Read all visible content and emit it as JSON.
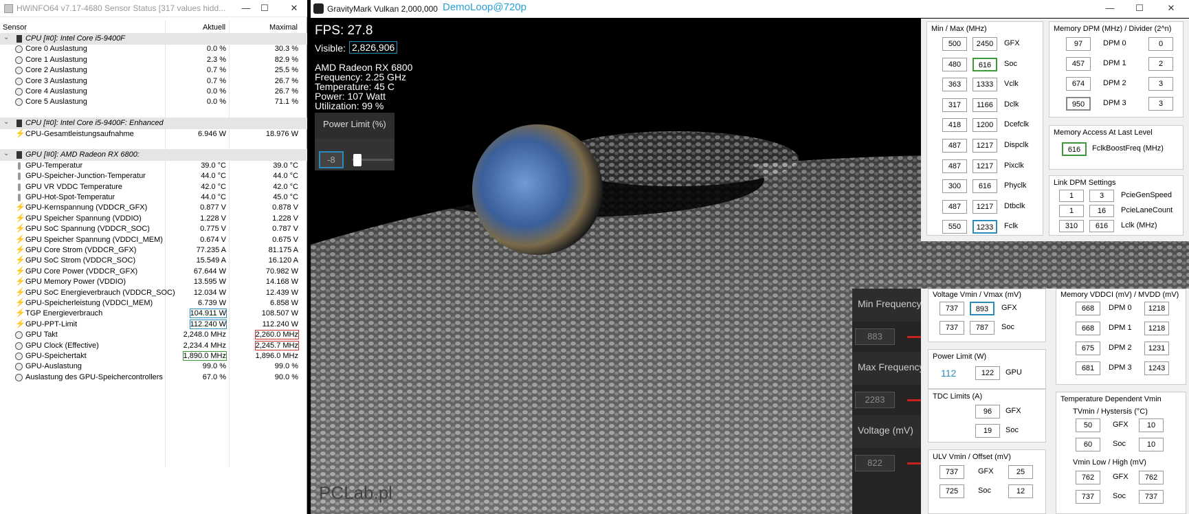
{
  "hwinfo": {
    "title": "HWiNFO64 v7.17-4680 Sensor Status [317 values hidd...",
    "columns": {
      "sensor": "Sensor",
      "current": "Aktuell",
      "max": "Maximal"
    },
    "groups": [
      {
        "label": "CPU [#0]: Intel Core i5-9400F",
        "rows": [
          {
            "label": "Core 0 Auslastung",
            "cur": "0.0 %",
            "max": "30.3 %",
            "icon": "circle-icon"
          },
          {
            "label": "Core 1 Auslastung",
            "cur": "2.3 %",
            "max": "82.9 %",
            "icon": "circle-icon"
          },
          {
            "label": "Core 2 Auslastung",
            "cur": "0.7 %",
            "max": "25.5 %",
            "icon": "circle-icon"
          },
          {
            "label": "Core 3 Auslastung",
            "cur": "0.7 %",
            "max": "26.7 %",
            "icon": "circle-icon"
          },
          {
            "label": "Core 4 Auslastung",
            "cur": "0.0 %",
            "max": "26.7 %",
            "icon": "circle-icon"
          },
          {
            "label": "Core 5 Auslastung",
            "cur": "0.0 %",
            "max": "71.1 %",
            "icon": "circle-icon"
          }
        ]
      },
      {
        "label": "CPU [#0]: Intel Core i5-9400F: Enhanced",
        "rows": [
          {
            "label": "CPU-Gesamtleistungsaufnahme",
            "cur": "6.946 W",
            "max": "18.976 W",
            "icon": "bolt-icon"
          }
        ]
      },
      {
        "label": "GPU [#0]: AMD Radeon RX 6800:",
        "rows": [
          {
            "label": "GPU-Temperatur",
            "cur": "39.0 °C",
            "max": "39.0 °C",
            "icon": "thermometer-icon"
          },
          {
            "label": "GPU-Speicher-Junction-Temperatur",
            "cur": "44.0 °C",
            "max": "44.0 °C",
            "icon": "thermometer-icon"
          },
          {
            "label": "GPU VR VDDC Temperature",
            "cur": "42.0 °C",
            "max": "42.0 °C",
            "icon": "thermometer-icon"
          },
          {
            "label": "GPU-Hot-Spot-Temperatur",
            "cur": "44.0 °C",
            "max": "45.0 °C",
            "icon": "thermometer-icon"
          },
          {
            "label": "GPU-Kernspannung (VDDCR_GFX)",
            "cur": "0.877 V",
            "max": "0.878 V",
            "icon": "bolt-icon"
          },
          {
            "label": "GPU Speicher Spannung (VDDIO)",
            "cur": "1.228 V",
            "max": "1.228 V",
            "icon": "bolt-icon"
          },
          {
            "label": "GPU SoC Spannung (VDDCR_SOC)",
            "cur": "0.775 V",
            "max": "0.787 V",
            "icon": "bolt-icon"
          },
          {
            "label": "GPU Speicher Spannung (VDDCI_MEM)",
            "cur": "0.674 V",
            "max": "0.675 V",
            "icon": "bolt-icon"
          },
          {
            "label": "GPU Core Strom (VDDCR_GFX)",
            "cur": "77.235 A",
            "max": "81.175 A",
            "icon": "bolt-icon"
          },
          {
            "label": "GPU SoC Strom (VDDCR_SOC)",
            "cur": "15.549 A",
            "max": "16.120 A",
            "icon": "bolt-icon"
          },
          {
            "label": "GPU Core Power (VDDCR_GFX)",
            "cur": "67.644 W",
            "max": "70.982 W",
            "icon": "bolt-icon"
          },
          {
            "label": "GPU Memory Power (VDDIO)",
            "cur": "13.595 W",
            "max": "14.168 W",
            "icon": "bolt-icon"
          },
          {
            "label": "GPU SoC Energieverbrauch (VDDCR_SOC)",
            "cur": "12.034 W",
            "max": "12.439 W",
            "icon": "bolt-icon"
          },
          {
            "label": "GPU-Speicherleistung (VDDCI_MEM)",
            "cur": "6.739 W",
            "max": "6.858 W",
            "icon": "bolt-icon"
          },
          {
            "label": "TGP Energieverbrauch",
            "cur": "104.911 W",
            "max": "108.507 W",
            "icon": "bolt-icon",
            "hl_cur": "blue"
          },
          {
            "label": "GPU-PPT-Limit",
            "cur": "112.240 W",
            "max": "112.240 W",
            "icon": "bolt-icon",
            "hl_cur": "blue"
          },
          {
            "label": "GPU Takt",
            "cur": "2,248.0 MHz",
            "max": "2,260.0 MHz",
            "icon": "circle-icon",
            "hl_max": "red"
          },
          {
            "label": "GPU Clock (Effective)",
            "cur": "2,234.4 MHz",
            "max": "2,245.7 MHz",
            "icon": "circle-icon",
            "hl_max": "red"
          },
          {
            "label": "GPU-Speichertakt",
            "cur": "1,890.0 MHz",
            "max": "1,896.0 MHz",
            "icon": "circle-icon",
            "hl_cur": "green"
          },
          {
            "label": "GPU-Auslastung",
            "cur": "99.0 %",
            "max": "99.0 %",
            "icon": "circle-icon"
          },
          {
            "label": "Auslastung des GPU-Speichercontrollers",
            "cur": "67.0 %",
            "max": "90.0 %",
            "icon": "circle-icon"
          }
        ]
      }
    ]
  },
  "gravitymark": {
    "title": "GravityMark Vulkan 2,000,000",
    "mode": "DemoLoop@720p",
    "fps": "FPS: 27.8",
    "visible_label": "Visible:",
    "visible_value": "2,826,906",
    "info": [
      "AMD Radeon RX 6800",
      "Frequency: 2.25 GHz",
      "Temperature: 45 C",
      "Power: 107 Watt",
      "Utilization: 99 %"
    ],
    "power_limit": {
      "label": "Power Limit (%)",
      "value": "-8"
    },
    "freq_panel": [
      {
        "label": "Min Frequency",
        "value": "883"
      },
      {
        "label": "Max Frequency",
        "value": "2283"
      },
      {
        "label": "Voltage (mV)",
        "value": "822"
      }
    ],
    "watermark": "PCLab.pl"
  },
  "mpt_top": {
    "minmax": {
      "title": "Min / Max (MHz)",
      "rows": [
        {
          "min": "500",
          "max": "2450",
          "label": "GFX"
        },
        {
          "min": "480",
          "max": "616",
          "label": "Soc",
          "hl": "green"
        },
        {
          "min": "363",
          "max": "1333",
          "label": "Vclk"
        },
        {
          "min": "317",
          "max": "1166",
          "label": "Dclk"
        },
        {
          "min": "418",
          "max": "1200",
          "label": "Dcefclk"
        },
        {
          "min": "487",
          "max": "1217",
          "label": "Dispclk"
        },
        {
          "min": "487",
          "max": "1217",
          "label": "Pixclk"
        },
        {
          "min": "300",
          "max": "616",
          "label": "Phyclk"
        },
        {
          "min": "487",
          "max": "1217",
          "label": "Dtbclk"
        },
        {
          "min": "550",
          "max": "1233",
          "label": "Fclk",
          "hl": "blue"
        }
      ]
    },
    "memdpm": {
      "title": "Memory DPM (MHz) / Divider (2^n)",
      "rows": [
        {
          "freq": "97",
          "label": "DPM 0",
          "div": "0"
        },
        {
          "freq": "457",
          "label": "DPM 1",
          "div": "2"
        },
        {
          "freq": "674",
          "label": "DPM 2",
          "div": "3"
        },
        {
          "freq": "950",
          "label": "DPM 3",
          "div": "3",
          "hl": "gray"
        }
      ]
    },
    "memaccess": {
      "title": "Memory Access At Last Level",
      "value": "616",
      "label": "FclkBoostFreq (MHz)"
    },
    "linkdpm": {
      "title": "Link DPM Settings",
      "rows": [
        {
          "a": "1",
          "b": "3",
          "label": "PcieGenSpeed"
        },
        {
          "a": "1",
          "b": "16",
          "label": "PcieLaneCount"
        },
        {
          "a": "310",
          "b": "616",
          "label": "Lclk (MHz)"
        }
      ]
    }
  },
  "mpt_bottom": {
    "voltage": {
      "title": "Voltage Vmin / Vmax (mV)",
      "rows": [
        {
          "min": "737",
          "max": "893",
          "label": "GFX",
          "hl": "blue"
        },
        {
          "min": "737",
          "max": "787",
          "label": "Soc"
        }
      ]
    },
    "powerlimit": {
      "title": "Power Limit (W)",
      "value_label": "112",
      "value": "122",
      "label": "GPU"
    },
    "tdc": {
      "title": "TDC Limits (A)",
      "rows": [
        {
          "value": "96",
          "label": "GFX"
        },
        {
          "value": "19",
          "label": "Soc"
        }
      ]
    },
    "ulv": {
      "title": "ULV Vmin / Offset (mV)",
      "rows": [
        {
          "a": "737",
          "label": "GFX",
          "b": "25"
        },
        {
          "a": "725",
          "label": "Soc",
          "b": "12"
        }
      ]
    },
    "memvddci": {
      "title": "Memory VDDCI (mV) / MVDD (mV)",
      "rows": [
        {
          "a": "668",
          "label": "DPM 0",
          "b": "1218"
        },
        {
          "a": "668",
          "label": "DPM 1",
          "b": "1218"
        },
        {
          "a": "675",
          "label": "DPM 2",
          "b": "1231"
        },
        {
          "a": "681",
          "label": "DPM 3",
          "b": "1243"
        }
      ]
    },
    "tempvmin": {
      "title": "Temperature Dependent Vmin",
      "sub1": "TVmin / Hystersis (°C)",
      "rows1": [
        {
          "a": "50",
          "label": "GFX",
          "b": "10"
        },
        {
          "a": "60",
          "label": "Soc",
          "b": "10"
        }
      ],
      "sub2": "Vmin Low / High (mV)",
      "rows2": [
        {
          "a": "762",
          "label": "GFX",
          "b": "762"
        },
        {
          "a": "737",
          "label": "Soc",
          "b": "737"
        }
      ]
    }
  }
}
